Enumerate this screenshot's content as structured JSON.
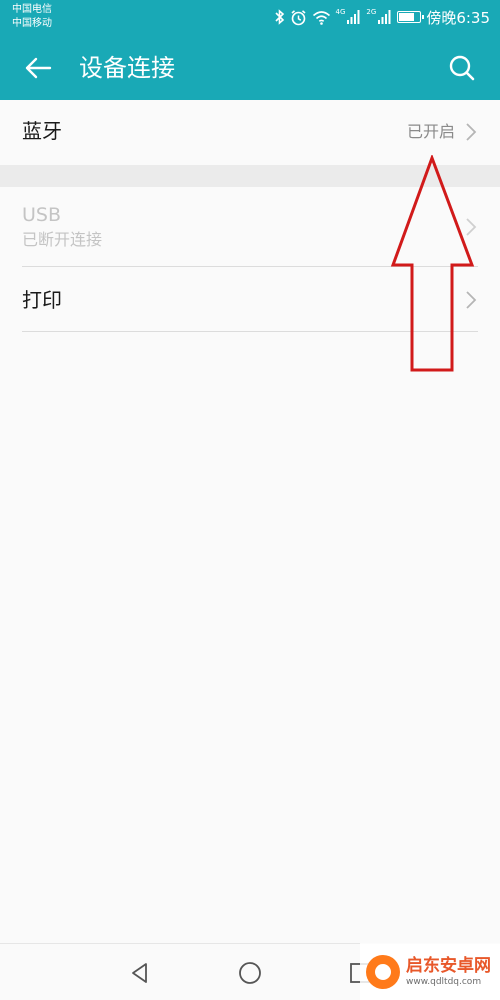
{
  "status_bar": {
    "carrier_1": "中国电信",
    "carrier_2": "中国移动",
    "network_tag_1": "4G",
    "network_tag_2": "2G",
    "time": "傍晚6:35",
    "battery_level": 0.75,
    "icons": [
      "bluetooth-icon",
      "alarm-icon",
      "wifi-icon",
      "signal-icon",
      "signal-icon",
      "battery-icon"
    ]
  },
  "app_bar": {
    "title": "设备连接",
    "back_icon": "arrow-left-icon",
    "search_icon": "search-icon",
    "background": "#19a9b6"
  },
  "settings": {
    "bluetooth": {
      "label": "蓝牙",
      "value": "已开启"
    },
    "usb": {
      "label": "USB",
      "subtitle": "已断开连接"
    },
    "print": {
      "label": "打印"
    }
  },
  "annotation": {
    "color": "#d11a1a",
    "shape": "arrow-up"
  },
  "nav_bar": {
    "icons": [
      "nav-back-icon",
      "nav-home-icon",
      "nav-recent-icon"
    ]
  },
  "watermark": {
    "name": "启东安卓网",
    "url": "www.qdltdq.com"
  }
}
